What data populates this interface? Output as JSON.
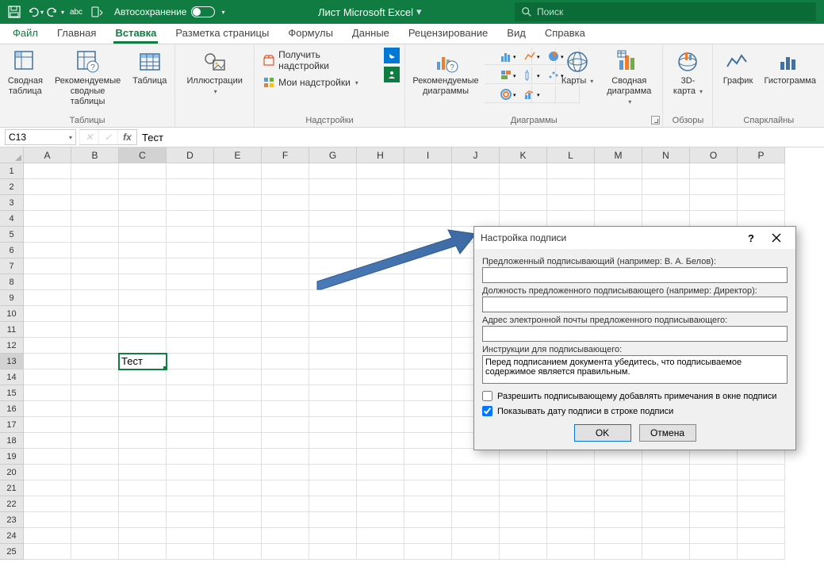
{
  "titlebar": {
    "autosave_label": "Автосохранение",
    "doc_title": "Лист Microsoft Excel",
    "search_placeholder": "Поиск"
  },
  "tabs": {
    "file": "Файл",
    "home": "Главная",
    "insert": "Вставка",
    "layout": "Разметка страницы",
    "formulas": "Формулы",
    "data": "Данные",
    "review": "Рецензирование",
    "view": "Вид",
    "help": "Справка"
  },
  "ribbon": {
    "tables": {
      "pivot": "Сводная\nтаблица",
      "rec_pivot": "Рекомендуемые\nсводные таблицы",
      "table": "Таблица",
      "group": "Таблицы"
    },
    "illustrations": {
      "btn": "Иллюстрации",
      "group": ""
    },
    "addins": {
      "get": "Получить надстройки",
      "my": "Мои надстройки",
      "group": "Надстройки"
    },
    "charts": {
      "rec": "Рекомендуемые\nдиаграммы",
      "maps": "Карты",
      "pivotchart": "Сводная\nдиаграмма",
      "group": "Диаграммы"
    },
    "tours": {
      "map3d": "3D-\nкарта",
      "group": "Обзоры"
    },
    "sparklines": {
      "line": "График",
      "column": "Гистограмма",
      "group": "Спарклайны"
    }
  },
  "formula_bar": {
    "namebox": "C13",
    "value": "Тест"
  },
  "grid": {
    "cols": [
      "A",
      "B",
      "C",
      "D",
      "E",
      "F",
      "G",
      "H",
      "I",
      "J",
      "K",
      "L",
      "M",
      "N",
      "O",
      "P"
    ],
    "rows": 25,
    "active_row": 13,
    "active_col": 3,
    "cell_value": "Тест"
  },
  "dialog": {
    "title": "Настройка подписи",
    "f1": "Предложенный подписывающий (например: В. А. Белов):",
    "f2": "Должность предложенного подписывающего (например: Директор):",
    "f3": "Адрес электронной почты предложенного подписывающего:",
    "f4": "Инструкции для подписывающего:",
    "instructions": "Перед подписанием документа убедитесь, что подписываемое содержимое является правильным.",
    "chk1": "Разрешить подписывающему добавлять примечания в окне подписи",
    "chk2": "Показывать дату подписи в строке подписи",
    "ok": "OK",
    "cancel": "Отмена"
  }
}
